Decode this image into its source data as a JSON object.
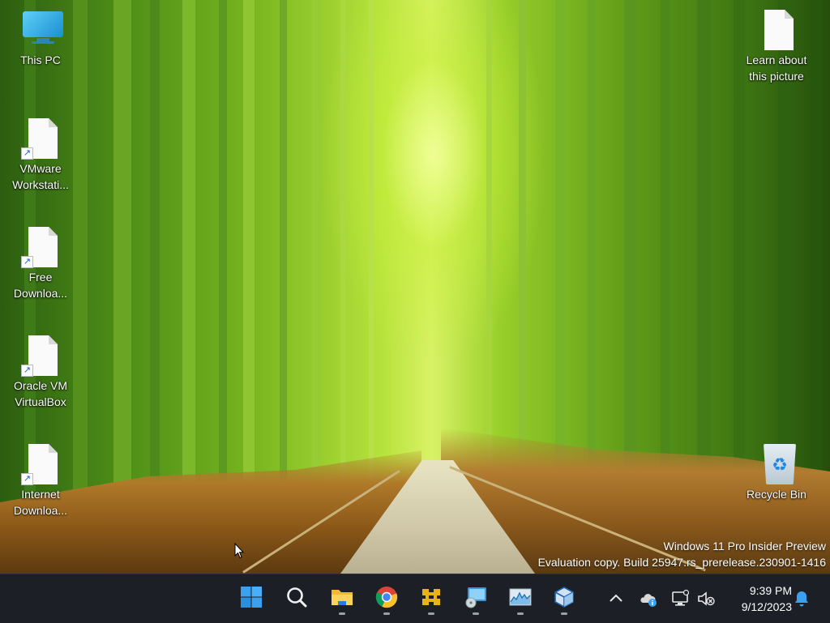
{
  "desktop": {
    "icons": [
      {
        "name": "this-pc",
        "label": "This PC"
      },
      {
        "name": "vmware",
        "label": "VMware Workstati..."
      },
      {
        "name": "free-download",
        "label": "Free Downloa..."
      },
      {
        "name": "virtualbox",
        "label": "Oracle VM VirtualBox"
      },
      {
        "name": "internet-download",
        "label": "Internet Downloa..."
      },
      {
        "name": "learn-picture",
        "label": "Learn about this picture"
      },
      {
        "name": "recycle-bin",
        "label": "Recycle Bin"
      }
    ]
  },
  "watermark": {
    "line1": "Windows 11 Pro Insider Preview",
    "line2": "Evaluation copy. Build 25947.rs_prerelease.230901-1416"
  },
  "taskbar": {
    "apps": [
      {
        "name": "start",
        "icon": "windows-logo-icon",
        "running": false
      },
      {
        "name": "search",
        "icon": "search-icon",
        "running": false
      },
      {
        "name": "file-explorer",
        "icon": "folder-icon",
        "running": true
      },
      {
        "name": "chrome",
        "icon": "chrome-icon",
        "running": true
      },
      {
        "name": "app-yellow",
        "icon": "network-grid-icon",
        "running": true
      },
      {
        "name": "app-monitor",
        "icon": "monitor-disc-icon",
        "running": true
      },
      {
        "name": "task-manager",
        "icon": "performance-chart-icon",
        "running": true
      },
      {
        "name": "virtualbox",
        "icon": "cube-icon",
        "running": true
      }
    ],
    "tray": {
      "overflow_icon": "chevron-up-icon",
      "onedrive_icon": "cloud-info-icon",
      "network_icon": "network-monitor-icon",
      "volume_icon": "volume-muted-icon",
      "notification_icon": "bell-icon"
    },
    "clock": {
      "time": "9:39 PM",
      "date": "9/12/2023"
    }
  },
  "colors": {
    "taskbar_bg": "#1c1f25",
    "accent": "#3aa0f0"
  }
}
